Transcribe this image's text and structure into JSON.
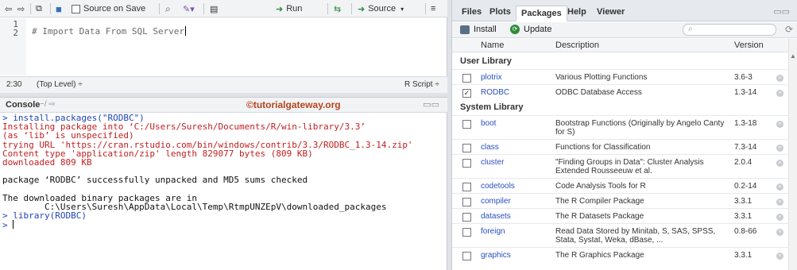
{
  "editor": {
    "toolbar": {
      "source_on_save": "Source on Save",
      "run": "Run",
      "source": "Source"
    },
    "line_numbers": [
      "1",
      "2"
    ],
    "code": "# Import Data From SQL Server",
    "status": {
      "position": "2:30",
      "scope": "(Top Level) ÷",
      "filetype": "R Script ÷"
    }
  },
  "console": {
    "title": "Console",
    "path": "~/",
    "watermark": "©tutorialgateway.org",
    "lines": [
      {
        "text": "> install.packages(\"RODBC\")",
        "kind": "cmd"
      },
      {
        "text": "Installing package into ‘C:/Users/Suresh/Documents/R/win-library/3.3’",
        "kind": "red"
      },
      {
        "text": "(as ‘lib’ is unspecified)",
        "kind": "red"
      },
      {
        "text": "trying URL 'https://cran.rstudio.com/bin/windows/contrib/3.3/RODBC_1.3-14.zip'",
        "kind": "red"
      },
      {
        "text": "Content type 'application/zip' length 829077 bytes (809 KB)",
        "kind": "red"
      },
      {
        "text": "downloaded 809 KB",
        "kind": "red"
      },
      {
        "text": "",
        "kind": "blk"
      },
      {
        "text": "package ‘RODBC’ successfully unpacked and MD5 sums checked",
        "kind": "blk"
      },
      {
        "text": "",
        "kind": "blk"
      },
      {
        "text": "The downloaded binary packages are in",
        "kind": "blk"
      },
      {
        "text": "        C:\\Users\\Suresh\\AppData\\Local\\Temp\\RtmpUNZEpV\\downloaded_packages",
        "kind": "blk"
      },
      {
        "text": "> library(RODBC)",
        "kind": "cmd"
      }
    ],
    "prompt": ">"
  },
  "packages_pane": {
    "tabs": [
      "Files",
      "Plots",
      "Packages",
      "Help",
      "Viewer"
    ],
    "active_tab": "Packages",
    "install": "Install",
    "update": "Update",
    "columns": {
      "name": "Name",
      "description": "Description",
      "version": "Version"
    },
    "user_library": {
      "title": "User Library",
      "rows": [
        {
          "checked": false,
          "name": "plotrix",
          "description": "Various Plotting Functions",
          "version": "3.6-3"
        },
        {
          "checked": true,
          "name": "RODBC",
          "description": "ODBC Database Access",
          "version": "1.3-14"
        }
      ]
    },
    "system_library": {
      "title": "System Library",
      "rows": [
        {
          "checked": false,
          "name": "boot",
          "description": "Bootstrap Functions (Originally by Angelo Canty for S)",
          "version": "1.3-18"
        },
        {
          "checked": false,
          "name": "class",
          "description": "Functions for Classification",
          "version": "7.3-14"
        },
        {
          "checked": false,
          "name": "cluster",
          "description": "\"Finding Groups in Data\": Cluster Analysis Extended Rousseeuw et al.",
          "version": "2.0.4"
        },
        {
          "checked": false,
          "name": "codetools",
          "description": "Code Analysis Tools for R",
          "version": "0.2-14"
        },
        {
          "checked": false,
          "name": "compiler",
          "description": "The R Compiler Package",
          "version": "3.3.1"
        },
        {
          "checked": false,
          "name": "datasets",
          "description": "The R Datasets Package",
          "version": "3.3.1"
        },
        {
          "checked": false,
          "name": "foreign",
          "description": "Read Data Stored by Minitab, S, SAS, SPSS, Stata, Systat, Weka, dBase, ...",
          "version": "0.8-66"
        },
        {
          "checked": false,
          "name": "graphics",
          "description": "The R Graphics Package",
          "version": "3.3.1"
        }
      ]
    }
  }
}
